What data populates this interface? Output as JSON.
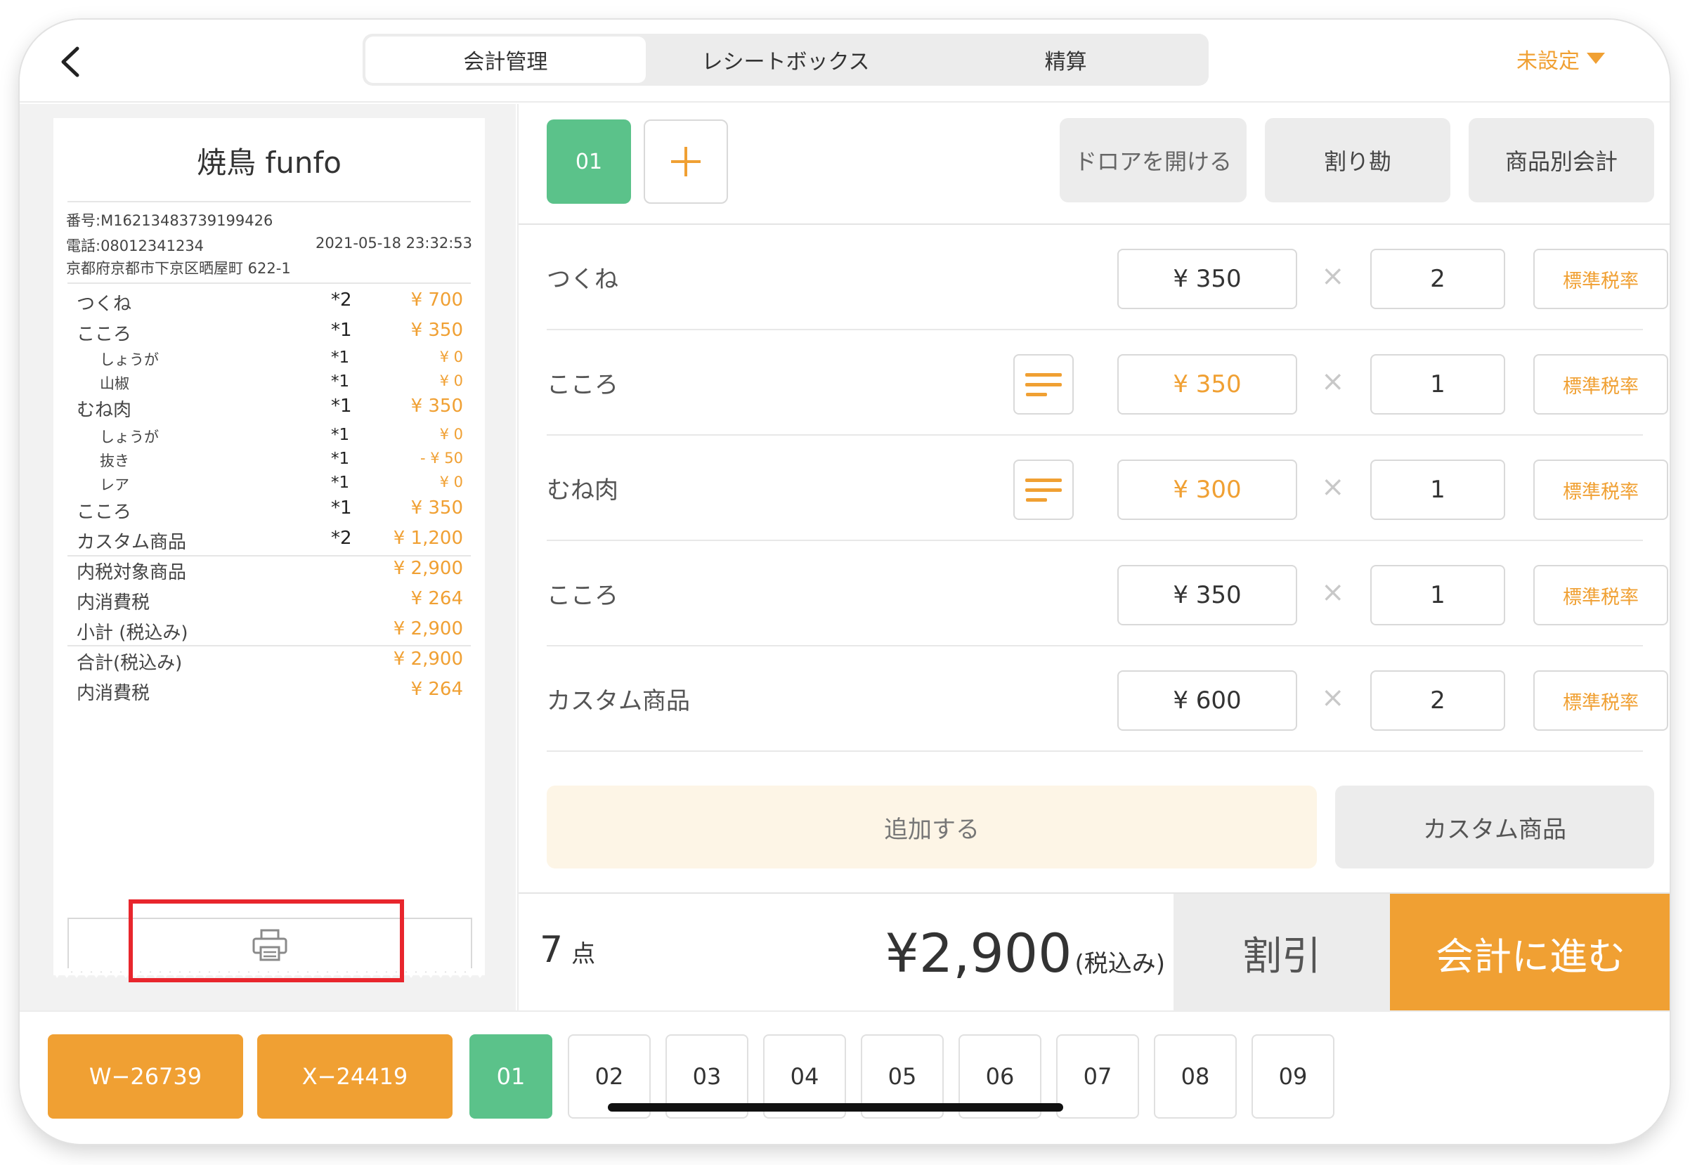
{
  "header": {
    "back_label": "<",
    "tabs": [
      {
        "label": "会計管理",
        "active": true
      },
      {
        "label": "レシートボックス",
        "active": false
      },
      {
        "label": "精算",
        "active": false
      }
    ],
    "status_dropdown": "未設定"
  },
  "receipt": {
    "shop_name": "焼鳥 funfo",
    "number": "番号:M16213483739199426",
    "phone": "電話:08012341234",
    "datetime": "2021-05-18 23:32:53",
    "address": "京都府京都市下京区晒屋町 622-1",
    "lines": [
      {
        "name": "つくね",
        "qty": "*2",
        "price": "¥ 700",
        "sub": false
      },
      {
        "name": "こころ",
        "qty": "*1",
        "price": "¥ 350",
        "sub": false
      },
      {
        "name": "しょうが",
        "qty": "*1",
        "price": "¥ 0",
        "sub": true
      },
      {
        "name": "山椒",
        "qty": "*1",
        "price": "¥ 0",
        "sub": true
      },
      {
        "name": "むね肉",
        "qty": "*1",
        "price": "¥ 350",
        "sub": false
      },
      {
        "name": "しょうが",
        "qty": "*1",
        "price": "¥ 0",
        "sub": true
      },
      {
        "name": "抜き",
        "qty": "*1",
        "price": "- ¥ 50",
        "sub": true
      },
      {
        "name": "レア",
        "qty": "*1",
        "price": "¥ 0",
        "sub": true
      },
      {
        "name": "こころ",
        "qty": "*1",
        "price": "¥ 350",
        "sub": false
      },
      {
        "name": "カスタム商品",
        "qty": "*2",
        "price": "¥ 1,200",
        "sub": false
      }
    ],
    "summary": [
      {
        "name": "内税対象商品",
        "price": "¥ 2,900"
      },
      {
        "name": "内消費税",
        "price": "¥ 264"
      },
      {
        "name": "小計 (税込み)",
        "price": "¥ 2,900"
      },
      {
        "name": "合計(税込み)",
        "price": "¥ 2,900"
      },
      {
        "name": "内消費税",
        "price": "¥ 264"
      }
    ]
  },
  "order": {
    "active_tab": "01",
    "add_tab_label": "+",
    "actions": {
      "drawer": "ドロアを開ける",
      "split": "割り勘",
      "by_item": "商品別会計"
    },
    "items": [
      {
        "name": "つくね",
        "price": "¥ 350",
        "qty": "2",
        "tax": "標準税率",
        "memo": false,
        "price_highlight": false
      },
      {
        "name": "こころ",
        "price": "¥ 350",
        "qty": "1",
        "tax": "標準税率",
        "memo": true,
        "price_highlight": true
      },
      {
        "name": "むね肉",
        "price": "¥ 300",
        "qty": "1",
        "tax": "標準税率",
        "memo": true,
        "price_highlight": true
      },
      {
        "name": "こころ",
        "price": "¥ 350",
        "qty": "1",
        "tax": "標準税率",
        "memo": false,
        "price_highlight": false
      },
      {
        "name": "カスタム商品",
        "price": "¥ 600",
        "qty": "2",
        "tax": "標準税率",
        "memo": false,
        "price_highlight": false
      }
    ],
    "times_symbol": "×",
    "add_label": "追加する",
    "custom_label": "カスタム商品"
  },
  "totals": {
    "count": "7",
    "count_unit": "点",
    "amount": "¥2,900",
    "tax_note": "(税込み)",
    "discount_label": "割引",
    "pay_label": "会計に進む"
  },
  "bottom_tabs": {
    "orange": [
      "W−26739",
      "X−24419"
    ],
    "tables": [
      "01",
      "02",
      "03",
      "04",
      "05",
      "06",
      "07",
      "08",
      "09"
    ],
    "active_table": "01"
  },
  "colors": {
    "accent_orange": "#f0a033",
    "active_green": "#5bc28a",
    "highlight_red": "#e8262d"
  }
}
